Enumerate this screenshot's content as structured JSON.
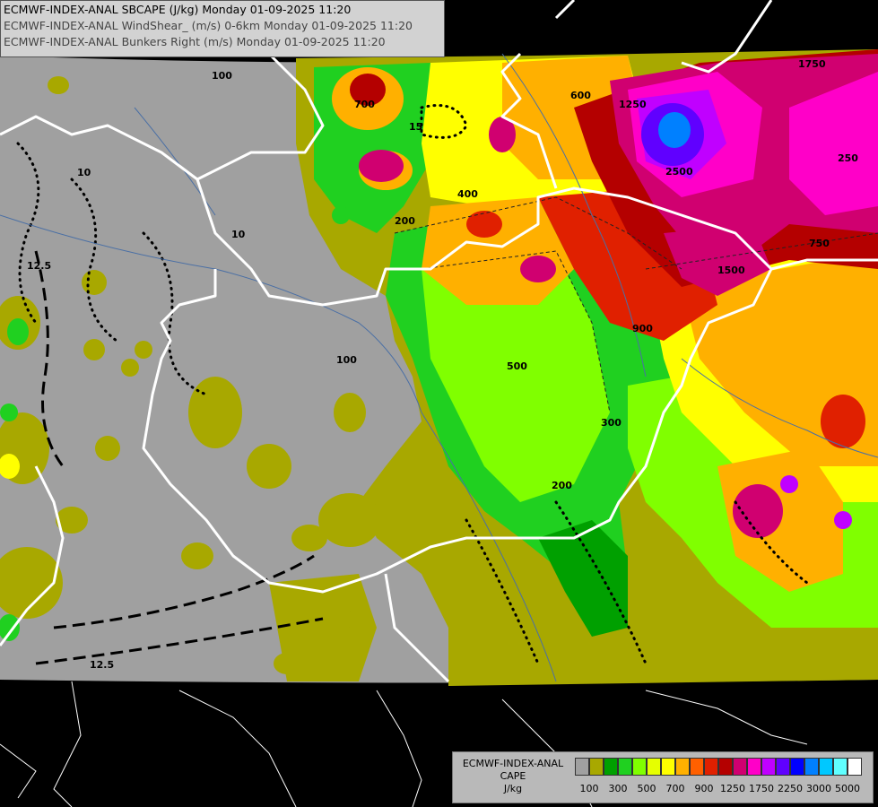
{
  "header": {
    "line1": "ECMWF-INDEX-ANAL SBCAPE (J/kg) Monday 01-09-2025 11:20",
    "line2": "ECMWF-INDEX-ANAL WindShear_ (m/s) 0-6km Monday 01-09-2025 11:20",
    "line3": "ECMWF-INDEX-ANAL Bunkers Right (m/s) Monday 01-09-2025 11:20"
  },
  "legend": {
    "title1": "ECMWF-INDEX-ANAL",
    "title2": "CAPE",
    "title3": "J/kg",
    "colors": [
      "#a0a0a0",
      "#a8a800",
      "#00a000",
      "#20d020",
      "#80ff00",
      "#e6ff00",
      "#ffff00",
      "#ffb000",
      "#ff6000",
      "#e02000",
      "#b40000",
      "#d00070",
      "#ff00c8",
      "#c000ff",
      "#6000ff",
      "#0000ff",
      "#0080ff",
      "#00c8ff",
      "#60ffff",
      "#ffffff"
    ],
    "ticks": [
      "100",
      "300",
      "500",
      "700",
      "900",
      "1250",
      "1750",
      "2250",
      "3000",
      "5000"
    ]
  },
  "contour_labels": [
    "700",
    "100",
    "200",
    "1250",
    "600",
    "1750",
    "1500",
    "750",
    "2500",
    "500",
    "250",
    "10",
    "12.5",
    "15",
    "300",
    "400",
    "900",
    "200",
    "100",
    "10",
    "12.5"
  ],
  "colors": {
    "background": "#000000",
    "domain": "#a0a0a0",
    "borders": "#ffffff",
    "rivers": "#4a6fa5"
  }
}
